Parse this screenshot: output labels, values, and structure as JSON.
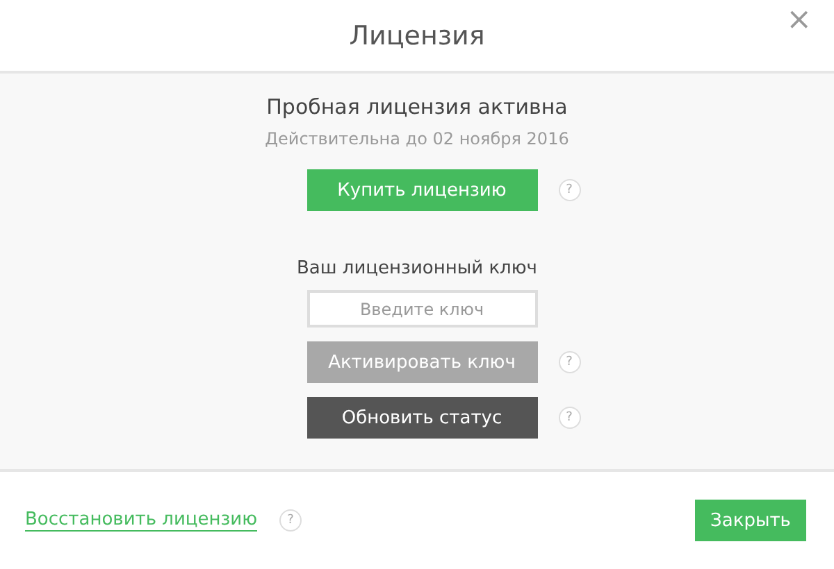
{
  "dialog": {
    "title": "Лицензия",
    "close_glyph": "×"
  },
  "status": {
    "heading": "Пробная лицензия активна",
    "valid_until": "Действительна до 02 ноября 2016"
  },
  "buy": {
    "label": "Купить лицензию",
    "kind": "primary",
    "help": "?"
  },
  "key": {
    "label": "Ваш лицензионный ключ",
    "placeholder": "Введите ключ"
  },
  "actions": [
    {
      "label": "Активировать ключ",
      "kind": "muted",
      "help": "?"
    },
    {
      "label": "Обновить статус",
      "kind": "dark",
      "help": "?"
    }
  ],
  "footer": {
    "restore_link": "Восстановить лицензию",
    "help": "?",
    "close_button": "Закрыть"
  }
}
